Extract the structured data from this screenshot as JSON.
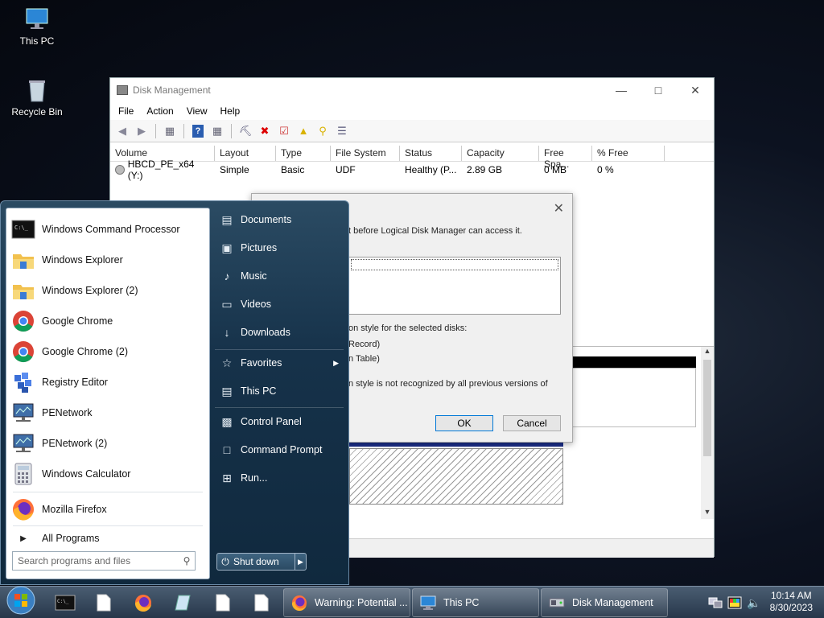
{
  "desktop": {
    "icons": [
      {
        "label": "This PC",
        "icon": "monitor-icon"
      },
      {
        "label": "Recycle Bin",
        "icon": "recycle-bin-icon"
      }
    ]
  },
  "disk_management": {
    "title": "Disk Management",
    "menu": [
      "File",
      "Action",
      "View",
      "Help"
    ],
    "columns": [
      "Volume",
      "Layout",
      "Type",
      "File System",
      "Status",
      "Capacity",
      "Free Spa...",
      "% Free"
    ],
    "rows": [
      {
        "volume": "HBCD_PE_x64 (Y:)",
        "layout": "Simple",
        "type": "Basic",
        "fs": "UDF",
        "status": "Healthy (P...",
        "capacity": "2.89 GB",
        "free": "0 MB",
        "pct_free": "0 %"
      }
    ]
  },
  "dialog": {
    "line1": "t before Logical Disk Manager can access it.",
    "line2": "on style for the selected disks:",
    "opt1": "Record)",
    "opt2": "n Table)",
    "line3": "n style is not recognized by all previous versions of",
    "ok": "OK",
    "cancel": "Cancel"
  },
  "start_menu": {
    "programs": [
      {
        "label": "Windows Command Processor",
        "icon": "cmd-icon"
      },
      {
        "label": "Windows Explorer",
        "icon": "folder-icon"
      },
      {
        "label": "Windows Explorer (2)",
        "icon": "folder-icon"
      },
      {
        "label": "Google Chrome",
        "icon": "chrome-icon"
      },
      {
        "label": "Google Chrome (2)",
        "icon": "chrome-icon"
      },
      {
        "label": "Registry Editor",
        "icon": "registry-icon"
      },
      {
        "label": "PENetwork",
        "icon": "network-icon"
      },
      {
        "label": "PENetwork (2)",
        "icon": "network-icon"
      },
      {
        "label": "Windows Calculator",
        "icon": "calculator-icon"
      },
      {
        "label": "Mozilla Firefox",
        "icon": "firefox-icon"
      }
    ],
    "all_programs": "All Programs",
    "search_placeholder": "Search programs and files",
    "right": [
      {
        "label": "Documents",
        "icon": "document-icon"
      },
      {
        "label": "Pictures",
        "icon": "picture-icon"
      },
      {
        "label": "Music",
        "icon": "music-icon"
      },
      {
        "label": "Videos",
        "icon": "video-icon"
      },
      {
        "label": "Downloads",
        "icon": "download-icon"
      },
      {
        "label": "Favorites",
        "icon": "star-icon"
      },
      {
        "label": "This PC",
        "icon": "computer-icon"
      },
      {
        "label": "Control Panel",
        "icon": "control-panel-icon"
      },
      {
        "label": "Command Prompt",
        "icon": "command-prompt-icon"
      },
      {
        "label": "Run...",
        "icon": "run-icon"
      }
    ],
    "shutdown": "Shut down"
  },
  "taskbar": {
    "buttons": [
      {
        "label": "Warning: Potential ...",
        "icon": "firefox-icon"
      },
      {
        "label": "This PC",
        "icon": "computer-icon"
      },
      {
        "label": "Disk Management",
        "icon": "disk-management-icon"
      }
    ],
    "time": "10:14 AM",
    "date": "8/30/2023"
  },
  "colors": {
    "accent": "#0078d7",
    "start_bg": "#16324a"
  }
}
